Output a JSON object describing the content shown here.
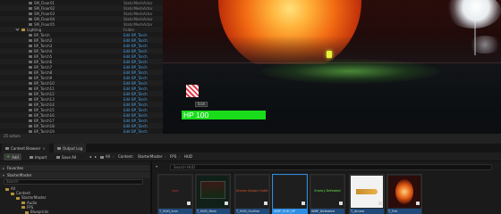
{
  "outliner": {
    "rows": [
      {
        "indent": 32,
        "name": "SM_Floor01",
        "type": "StaticMeshActor",
        "type_style": "plain",
        "icon": "mesh"
      },
      {
        "indent": 32,
        "name": "SM_Floor02",
        "type": "StaticMeshActor",
        "type_style": "plain",
        "icon": "mesh"
      },
      {
        "indent": 32,
        "name": "SM_Floor03",
        "type": "StaticMeshActor",
        "type_style": "plain",
        "icon": "mesh"
      },
      {
        "indent": 32,
        "name": "SM_Floor04",
        "type": "StaticMeshActor",
        "type_style": "plain",
        "icon": "mesh"
      },
      {
        "indent": 32,
        "name": "SM_Floor05",
        "type": "StaticMeshActor",
        "type_style": "plain",
        "icon": "mesh"
      },
      {
        "indent": 24,
        "name": "Lighting",
        "type": "Folder",
        "type_style": "plain",
        "icon": "folder"
      },
      {
        "indent": 32,
        "name": "BP_Torch",
        "type": "Edit BP_Torch",
        "type_style": "link",
        "icon": "bp"
      },
      {
        "indent": 32,
        "name": "BP_Torch2",
        "type": "Edit BP_Torch",
        "type_style": "link",
        "icon": "bp"
      },
      {
        "indent": 32,
        "name": "BP_Torch3",
        "type": "Edit BP_Torch",
        "type_style": "link",
        "icon": "bp"
      },
      {
        "indent": 32,
        "name": "BP_Torch4",
        "type": "Edit BP_Torch",
        "type_style": "link",
        "icon": "bp"
      },
      {
        "indent": 32,
        "name": "BP_Torch5",
        "type": "Edit BP_Torch",
        "type_style": "link",
        "icon": "bp"
      },
      {
        "indent": 32,
        "name": "BP_Torch6",
        "type": "Edit BP_Torch",
        "type_style": "link",
        "icon": "bp"
      },
      {
        "indent": 32,
        "name": "BP_Torch7",
        "type": "Edit BP_Torch",
        "type_style": "link",
        "icon": "bp"
      },
      {
        "indent": 32,
        "name": "BP_Torch8",
        "type": "Edit BP_Torch",
        "type_style": "link",
        "icon": "bp"
      },
      {
        "indent": 32,
        "name": "BP_Torch9",
        "type": "Edit BP_Torch",
        "type_style": "link",
        "icon": "bp"
      },
      {
        "indent": 32,
        "name": "BP_Torch10",
        "type": "Edit BP_Torch",
        "type_style": "link",
        "icon": "bp"
      },
      {
        "indent": 32,
        "name": "BP_Torch11",
        "type": "Edit BP_Torch",
        "type_style": "link",
        "icon": "bp"
      },
      {
        "indent": 32,
        "name": "BP_Torch12",
        "type": "Edit BP_Torch",
        "type_style": "link",
        "icon": "bp"
      },
      {
        "indent": 32,
        "name": "BP_Torch13",
        "type": "Edit BP_Torch",
        "type_style": "link",
        "icon": "bp"
      },
      {
        "indent": 32,
        "name": "BP_Torch14",
        "type": "Edit BP_Torch",
        "type_style": "link",
        "icon": "bp"
      },
      {
        "indent": 32,
        "name": "BP_Torch15",
        "type": "Edit BP_Torch",
        "type_style": "link",
        "icon": "bp"
      },
      {
        "indent": 32,
        "name": "BP_Torch16",
        "type": "Edit BP_Torch",
        "type_style": "link",
        "icon": "bp"
      },
      {
        "indent": 32,
        "name": "BP_Torch17",
        "type": "Edit BP_Torch",
        "type_style": "link",
        "icon": "bp"
      },
      {
        "indent": 32,
        "name": "BP_Torch18",
        "type": "Edit BP_Torch",
        "type_style": "link",
        "icon": "bp"
      },
      {
        "indent": 32,
        "name": "BP_Torch19",
        "type": "Edit BP_Torch",
        "type_style": "link",
        "icon": "bp"
      }
    ],
    "footer_label": "25 actors"
  },
  "viewport": {
    "hud": {
      "icon_label": "Icon",
      "hp_text": "HP 100",
      "hp_fraction": 1.0,
      "hp_color": "#19dd1b"
    }
  },
  "tabs": [
    {
      "label": "Content Browser",
      "state": "active"
    },
    {
      "label": "Output Log",
      "state": "inactive"
    }
  ],
  "toolbar": {
    "add_label": "Add",
    "import_label": "Import",
    "save_all_label": "Save All",
    "breadcrumb": [
      "All",
      "Content",
      "StarterMaster",
      "FPS",
      "HUD"
    ]
  },
  "sources": {
    "favorites_label": "Favorites",
    "project_label": "StarterMaster",
    "search_placeholder": "Search",
    "tree": [
      {
        "label": "All",
        "indent": 6
      },
      {
        "label": "Content",
        "indent": 12
      },
      {
        "label": "StarterMaster",
        "indent": 18
      },
      {
        "label": "Audio",
        "indent": 24
      },
      {
        "label": "FPS",
        "indent": 24
      },
      {
        "label": "Blueprints",
        "indent": 28
      }
    ]
  },
  "assets": {
    "filter_label": "Filters",
    "search_placeholder": "Search HUD",
    "items": [
      {
        "thumb_text": "Icon",
        "thumb_color": "#d13a3a",
        "thumb_bg": "#1e1e1e",
        "name": "T_HUD_Icon",
        "selected": false
      },
      {
        "thumb_text": "",
        "thumb_color": "#ffffff",
        "thumb_bg": "#102018",
        "name": "T_HUD_Main",
        "selected": false
      },
      {
        "thumb_text": "Enemy Spawn Outline",
        "thumb_color": "#e0552a",
        "thumb_bg": "#1e1e1e",
        "name": "T_HUD_Outline",
        "selected": false
      },
      {
        "thumb_text": "",
        "thumb_color": "#ffffff",
        "thumb_bg": "#1e1e1e",
        "name": "WBP_HUD_HP",
        "selected": true
      },
      {
        "thumb_text": "Enemy Defeated",
        "thumb_color": "#6ee04a",
        "thumb_bg": "#1e1e1e",
        "name": "WBP_Defeated",
        "selected": false
      },
      {
        "thumb_text": "",
        "thumb_color": "#ffffff",
        "thumb_bg": "#f2f2f2",
        "name": "T_Ammo",
        "selected": false
      },
      {
        "thumb_text": "",
        "thumb_color": "#ffffff",
        "thumb_bg": "#2a0d0b",
        "name": "T_Fire",
        "selected": false
      }
    ]
  }
}
